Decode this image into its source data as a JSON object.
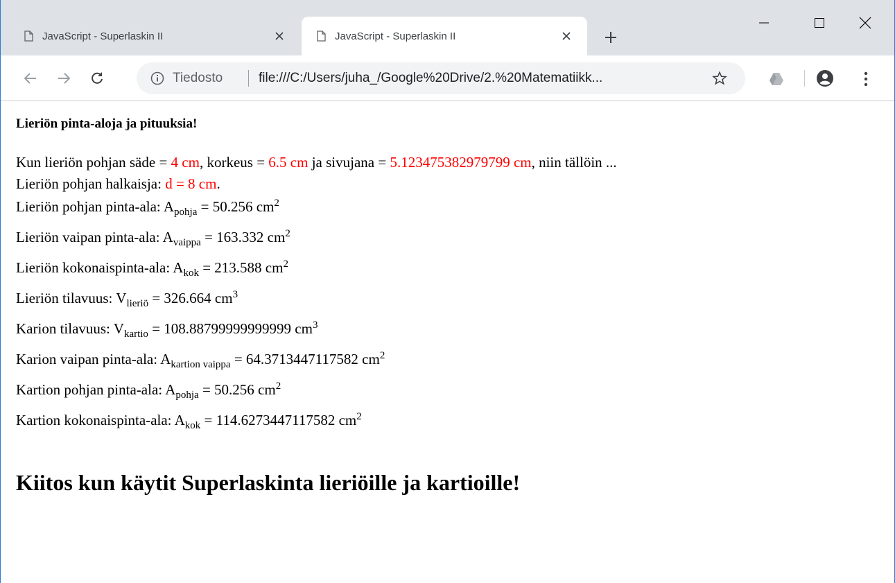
{
  "browser": {
    "tabs": [
      {
        "title": "JavaScript - Superlaskin II",
        "active": false
      },
      {
        "title": "JavaScript - Superlaskin II",
        "active": true
      }
    ],
    "scheme_label": "Tiedosto",
    "url": "file:///C:/Users/juha_/Google%20Drive/2.%20Matematiikk...",
    "icons": {
      "back": "arrow-left-icon",
      "forward": "arrow-right-icon",
      "reload": "reload-icon",
      "info": "info-icon",
      "star": "star-icon",
      "drive": "google-drive-icon",
      "account": "account-icon",
      "menu": "kebab-menu-icon"
    }
  },
  "page": {
    "heading": "Lieriön pinta-aloja ja pituuksia!",
    "intro": {
      "p1": "Kun lieriön pohjan säde = ",
      "radius": "4 cm",
      "p2": ", korkeus = ",
      "height": "6.5 cm",
      "p3": " ja sivujana = ",
      "slant": "5.123475382979799 cm",
      "p4": ", niin tällöin ..."
    },
    "diameter": {
      "label": "Lieriön pohjan halkaisja: ",
      "value": "d = 8 cm",
      "end": "."
    },
    "rows": [
      {
        "label": "Lieriön pohjan pinta-ala: ",
        "sym": "A",
        "sub": "pohja",
        "value": " = 50.256 cm",
        "pow": "2"
      },
      {
        "label": "Lieriön vaipan pinta-ala: ",
        "sym": "A",
        "sub": "vaippa",
        "value": " = 163.332 cm",
        "pow": "2"
      },
      {
        "label": "Lieriön kokonaispinta-ala: ",
        "sym": "A",
        "sub": "kok",
        "value": " = 213.588 cm",
        "pow": "2"
      },
      {
        "label": "Lieriön tilavuus: ",
        "sym": "V",
        "sub": "lieriö",
        "value": " = 326.664 cm",
        "pow": "3"
      },
      {
        "label": "Karion tilavuus: ",
        "sym": "V",
        "sub": "kartio",
        "value": " = 108.88799999999999 cm",
        "pow": "3"
      },
      {
        "label": "Karion vaipan pinta-ala: ",
        "sym": "A",
        "sub": "kartion vaippa",
        "value": " = 64.3713447117582 cm",
        "pow": "2"
      },
      {
        "label": "Kartion pohjan pinta-ala: ",
        "sym": "A",
        "sub": "pohja",
        "value": " = 50.256 cm",
        "pow": "2"
      },
      {
        "label": "Kartion kokonaispinta-ala: ",
        "sym": "A",
        "sub": "kok",
        "value": " = 114.6273447117582 cm",
        "pow": "2"
      }
    ],
    "thanks": "Kiitos kun käytit Superlaskinta lieriöille ja kartioille!"
  }
}
